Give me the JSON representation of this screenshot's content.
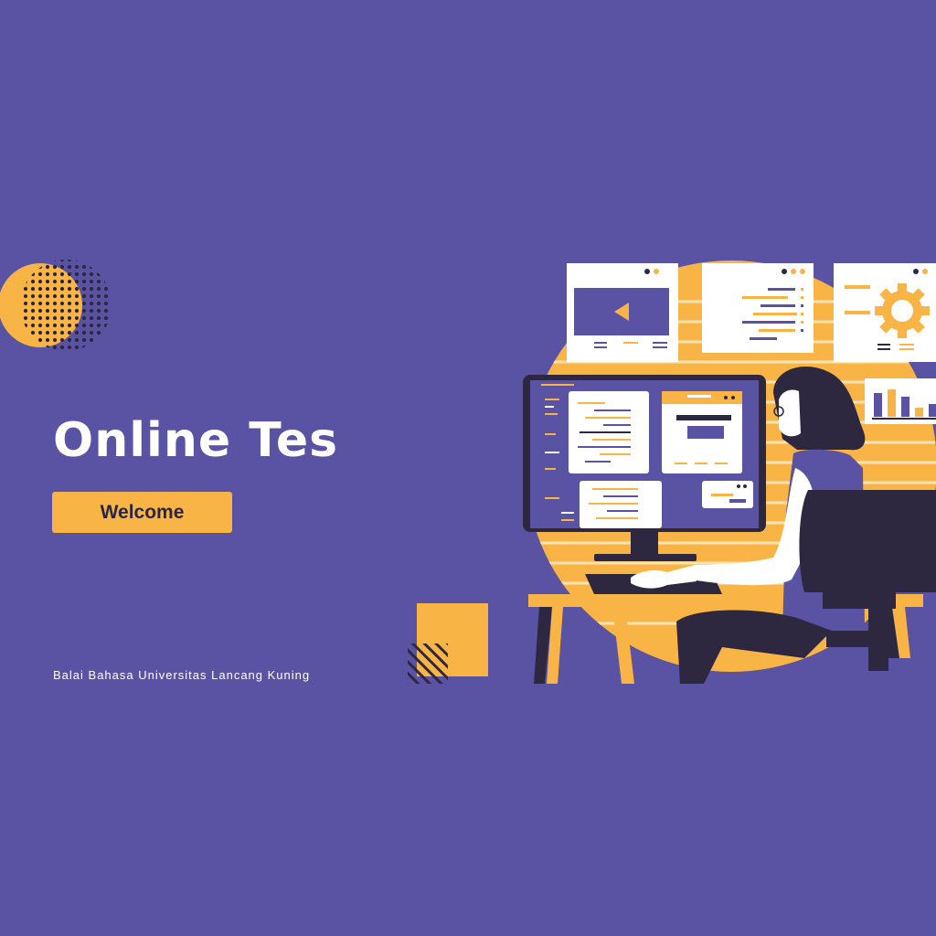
{
  "hero": {
    "title": "Online Tes",
    "welcome_label": "Welcome",
    "footer": "Balai Bahasa Universitas Lancang Kuning"
  },
  "colors": {
    "background": "#5A52A2",
    "accent": "#F9B446",
    "dark": "#2D2740",
    "text": "#FFFFFF"
  },
  "illustration": {
    "subject": "person-working-at-computer",
    "panels": [
      "video-player-panel",
      "code-panel",
      "settings-gear-panel",
      "bar-chart-panel"
    ]
  }
}
